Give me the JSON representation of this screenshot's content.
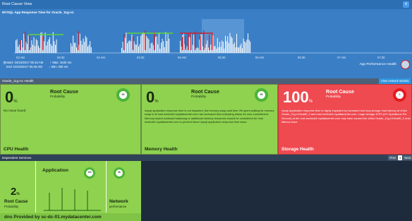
{
  "window": {
    "title": "Root Cause View",
    "close_glyph": "x"
  },
  "chart": {
    "title": "MYSQL App Response Time for Oracle_11g-n1",
    "time_labels": [
      "03 AM",
      "03:30",
      "04 AM",
      "04:30",
      "05 AM",
      "05:30",
      "06 AM",
      "06:30",
      "07 AM",
      "07:30"
    ],
    "start": "Start: 04/16/2017 05:16 AM",
    "end": "End: 04/16/2017 05:45 AM",
    "max": "Max: 1532 ms",
    "min": "Min: 350 ms",
    "app_performance_health": "App Performance Health"
  },
  "host": {
    "title": "Oracle_11g-n1 Health",
    "button": "View network statistic"
  },
  "cards": {
    "cpu": {
      "pct": "0",
      "unit": "%",
      "root_cause": "Root Cause",
      "probability": "Probability",
      "score": "99",
      "message": "No issue found",
      "footer": "CPU Health"
    },
    "memory": {
      "pct": "0",
      "unit": "%",
      "root_cause": "Root Cause",
      "probability": "Probability",
      "score": "99",
      "message": "mysql application response time is not impacted, but memory swap-wait time VM spent waiting for memory swap in at host esxhost4.mydatacenter.com has increased thus indicating stress for over-commitment. Memory based workload balancing or additional memory resources should be considered for host esxhost4.mydatacenter.com to prevent future mysql application response time issue.",
      "footer": "Memory Health"
    },
    "storage": {
      "pct": "100",
      "unit": "%",
      "root_cause": "Root Cause",
      "probability": "Probability",
      "score": "0",
      "message": "mysql application response time is highly impacted by increased and long storage read latency at vDisk Oracle_11g-n1Hosti0_0 and host esxhost4.mydatacenter.com. Large storage IOPS (I/O Operations Per Second) at the host esxhost4.mydatacenter.com may have caused the vDisk Oracle_11g-n1Hosti0_0 read latency issue.",
      "footer": "Storage Health"
    }
  },
  "dependent": {
    "title": "Dependent Services",
    "pager": [
      "Prev",
      "1",
      "Next"
    ],
    "count": "2",
    "unit": "%",
    "root_cause": "Root Cause",
    "probability": "Probability",
    "application": "Application",
    "app_score": "100",
    "network": "Network",
    "performance": "performance",
    "net_score": "96",
    "dns": "dns Provided by sc-dc-01.mydatacenter.com"
  },
  "colors": {
    "healthy": "#8ed24f",
    "critical": "#ee4a50",
    "accent": "#2c6fb3"
  }
}
